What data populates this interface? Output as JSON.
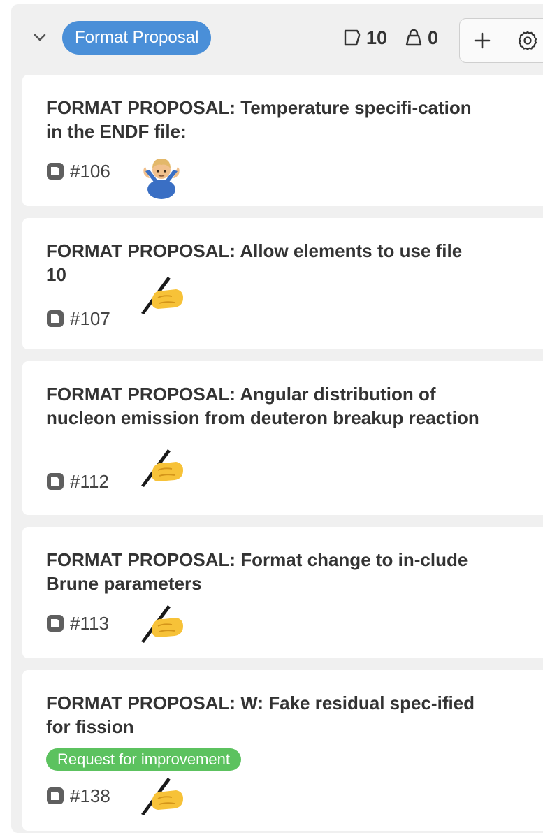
{
  "header": {
    "group_label": "Format Proposal",
    "issue_count": "10",
    "pr_count": "0"
  },
  "cards": [
    {
      "title": "FORMAT PROPOSAL: Temperature specifi-cation in the ENDF file:",
      "number": "#106",
      "emoji": "person-shrugging-icon"
    },
    {
      "title": "FORMAT PROPOSAL: Allow elements to use file 10",
      "number": "#107",
      "emoji": "writing-hand-icon"
    },
    {
      "title": "FORMAT PROPOSAL: Angular distribution of nucleon emission from deuteron breakup reaction",
      "number": "#112",
      "emoji": "writing-hand-icon"
    },
    {
      "title": "FORMAT PROPOSAL: Format change to in-clude Brune parameters",
      "number": "#113",
      "emoji": "writing-hand-icon"
    },
    {
      "title": "FORMAT PROPOSAL: W: Fake residual spec-ified for fission",
      "number": "#138",
      "emoji": "writing-hand-icon",
      "label": "Request for improvement"
    }
  ],
  "colors": {
    "group_pill": "#4a8fd8",
    "label_green": "#5cc25f",
    "column_bg": "#f0f0f0"
  }
}
